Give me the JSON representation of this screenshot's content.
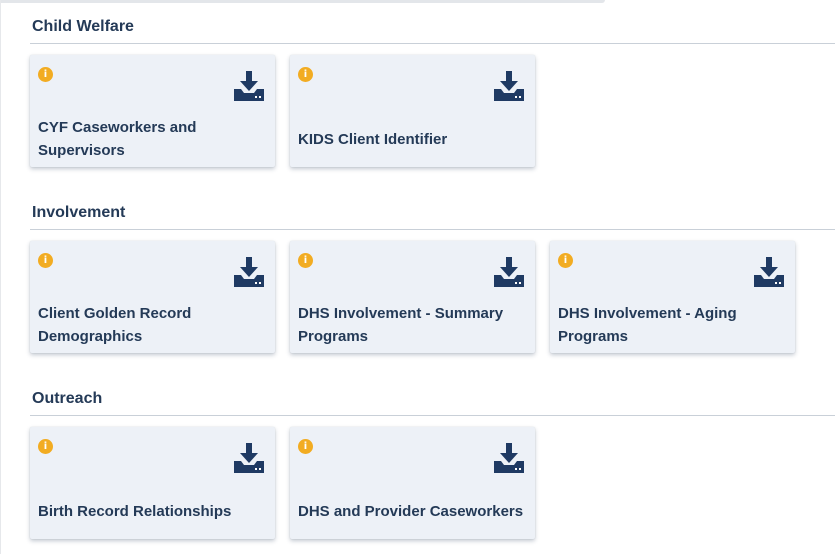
{
  "sections": [
    {
      "title": "Child Welfare",
      "cards": [
        {
          "label": "CYF Caseworkers and Supervisors",
          "info_icon": "info-icon",
          "action_icon": "download-icon"
        },
        {
          "label": "KIDS Client Identifier",
          "info_icon": "info-icon",
          "action_icon": "download-icon"
        }
      ]
    },
    {
      "title": "Involvement",
      "cards": [
        {
          "label": "Client Golden Record Demographics",
          "info_icon": "info-icon",
          "action_icon": "download-icon"
        },
        {
          "label": "DHS Involvement - Summary Programs",
          "info_icon": "info-icon",
          "action_icon": "download-icon"
        },
        {
          "label": "DHS Involvement - Aging Programs",
          "info_icon": "info-icon",
          "action_icon": "download-icon"
        }
      ]
    },
    {
      "title": "Outreach",
      "cards": [
        {
          "label": "Birth Record Relationships",
          "info_icon": "info-icon",
          "action_icon": "download-icon"
        },
        {
          "label": "DHS and Provider Caseworkers",
          "info_icon": "info-icon",
          "action_icon": "download-icon"
        }
      ]
    }
  ],
  "info_glyph": "i",
  "colors": {
    "heading": "#243a57",
    "card_background": "#edf1f7",
    "info_badge": "#f2ac22",
    "download_icon": "#1f3a63"
  }
}
